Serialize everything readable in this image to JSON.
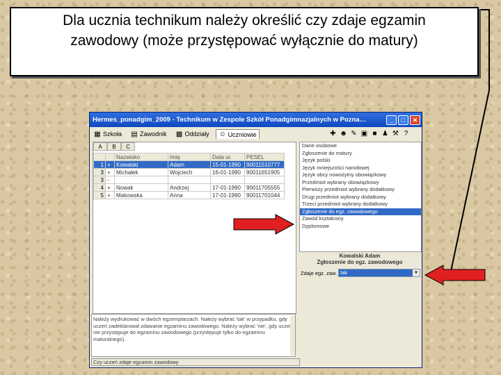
{
  "callout": {
    "line1": "Dla ucznia technikum należy określić czy zdaje egzamin",
    "line2": "zawodowy (może przystępować wyłącznie do matury)"
  },
  "window": {
    "title": "Hermes_ponadgim_2009 - Technikum w Zespole Szkół Ponadgimnazjalnych w Pozna…",
    "tabs": [
      {
        "label": "Szkoła",
        "icon": "school-icon"
      },
      {
        "label": "Zawodnik",
        "icon": "book-icon"
      },
      {
        "label": "Oddziały",
        "icon": "group-icon"
      },
      {
        "label": "Uczniowie",
        "icon": "student-icon"
      }
    ],
    "small_tabs": [
      "A",
      "B",
      "C"
    ],
    "grid": {
      "headers": [
        "",
        "",
        "Nazwisko",
        "Imię",
        "Data ur.",
        "PESEL"
      ],
      "rows": [
        {
          "n": "1",
          "m": "+",
          "nazwisko": "Kowalski",
          "imie": "Adam",
          "data": "15-01-1990",
          "pesel": "90011510777",
          "selected": true
        },
        {
          "n": "3",
          "m": "+",
          "nazwisko": "Michałek",
          "imie": "Wojciech",
          "data": "16-01-1990",
          "pesel": "90011651905",
          "selected": false
        },
        {
          "n": "3",
          "m": "-",
          "nazwisko": "",
          "imie": "",
          "data": "",
          "pesel": "",
          "selected": false
        },
        {
          "n": "4",
          "m": "+",
          "nazwisko": "Nowak",
          "imie": "Andrzej",
          "data": "17-01-1990",
          "pesel": "90011705555",
          "selected": false
        },
        {
          "n": "5",
          "m": "+",
          "nazwisko": "Makowska",
          "imie": "Anna",
          "data": "17-01-1990",
          "pesel": "90011701044",
          "selected": false
        }
      ]
    },
    "list": [
      "Dane osobowe",
      "Zgłoszenie do matury",
      "Język polski",
      "Język mniejszości narodowej",
      "Język obcy nowożytny obowiązkowy",
      "Przedmiot wybrany obowiązkowy",
      "Pierwszy przedmiot wybrany dodatkowy",
      "Drugi przedmiot wybrany dodatkowy",
      "Trzeci przedmiot wybrany dodatkowy",
      "Zgłoszenie do egz. zawodowego",
      "Zawód kształcony",
      "Dyplomowe"
    ],
    "selected_list_index": 9,
    "student_name": "Kowalski Adam",
    "section_title": "Zgłoszenie do egz. zawodowego",
    "combo_label": "Zdaje egz. zaw.",
    "combo_value": "tak",
    "notes": "Należy wydrukować w dwóch egzemplarzach. Należy wybrać 'tak' w przypadku, gdy uczeń zadeklarował zdawanie egzaminu zawodowego. Należy wybrać 'nie', gdy uczeń nie przystępuje do egzaminu zawodowego (przystępuje tylko do egzaminu maturalnego).",
    "status": "Czy uczeń zdaje egzamin zawodowy"
  },
  "colors": {
    "arrow": "#e02020",
    "selection": "#316ac5",
    "titlebar": "#0f48c0"
  }
}
